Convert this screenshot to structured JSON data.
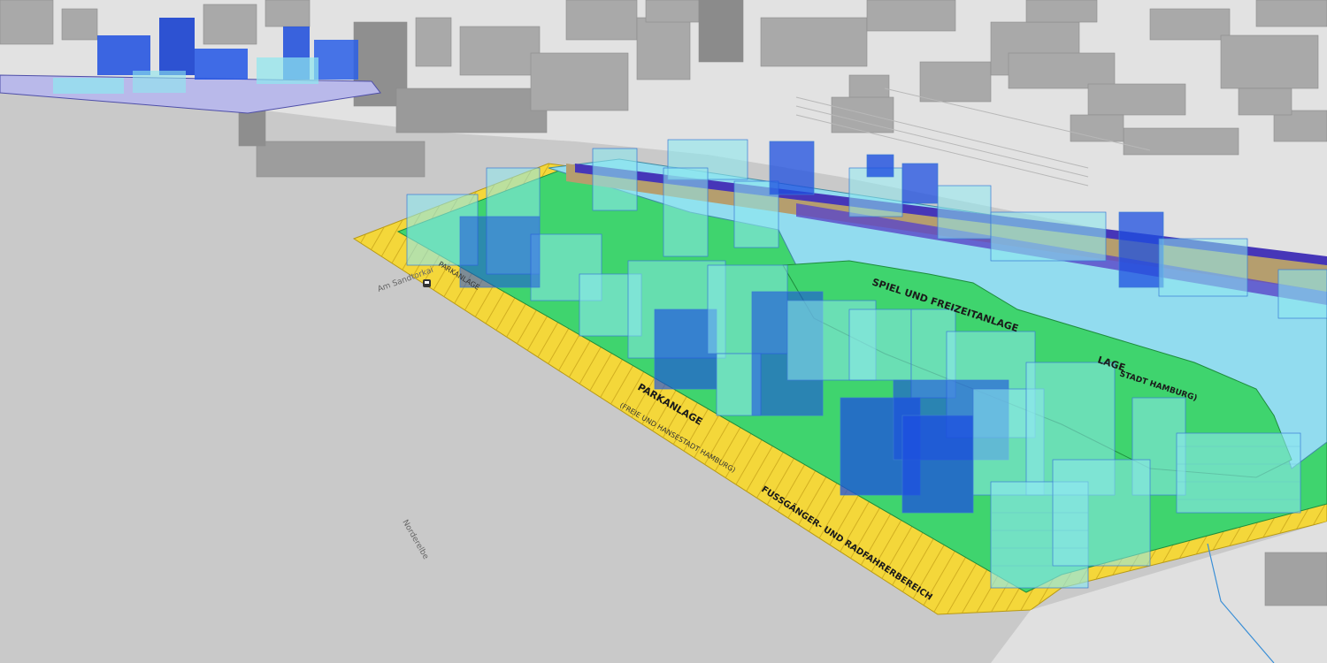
{
  "colors": {
    "water": "#c9c9c9",
    "land": "#e1e1e1",
    "city_block": "#d9d9d9",
    "city_building": "#9c9c9c",
    "plan_yellow": "#f4d73a",
    "plan_green": "#3fd46e",
    "plan_water": "#92dcef",
    "plan_tan": "#b59e6e",
    "plan_purple": "#4636b8",
    "glass_building": "#8ee8ef",
    "planned_building_blue": "#1d4fe0"
  },
  "plan_labels": {
    "spiel_und_freizeitanlage": "SPIEL UND FREIZEITANLAGE",
    "freie_hansestadt": "FREIE UND HANSESTADT HAMBURG",
    "parkanlage": "PARKANLAGE",
    "parkanlage_sub": "(FREIE UND HANSESTADT HAMBURG)",
    "parkanlage_west": "PARKANLAGE",
    "fussganger": "FUSSGÄNGER- UND RADFAHRERBEREICH",
    "lage_fragment": "LAGE",
    "stadt_hamburg": "STADT HAMBURG)"
  },
  "streets": {
    "am_sandtorkai": "Am Sandtorkai",
    "norderelbe": "Norderelbe"
  },
  "icons": {
    "transit_stop": "ferry-stop-icon"
  }
}
